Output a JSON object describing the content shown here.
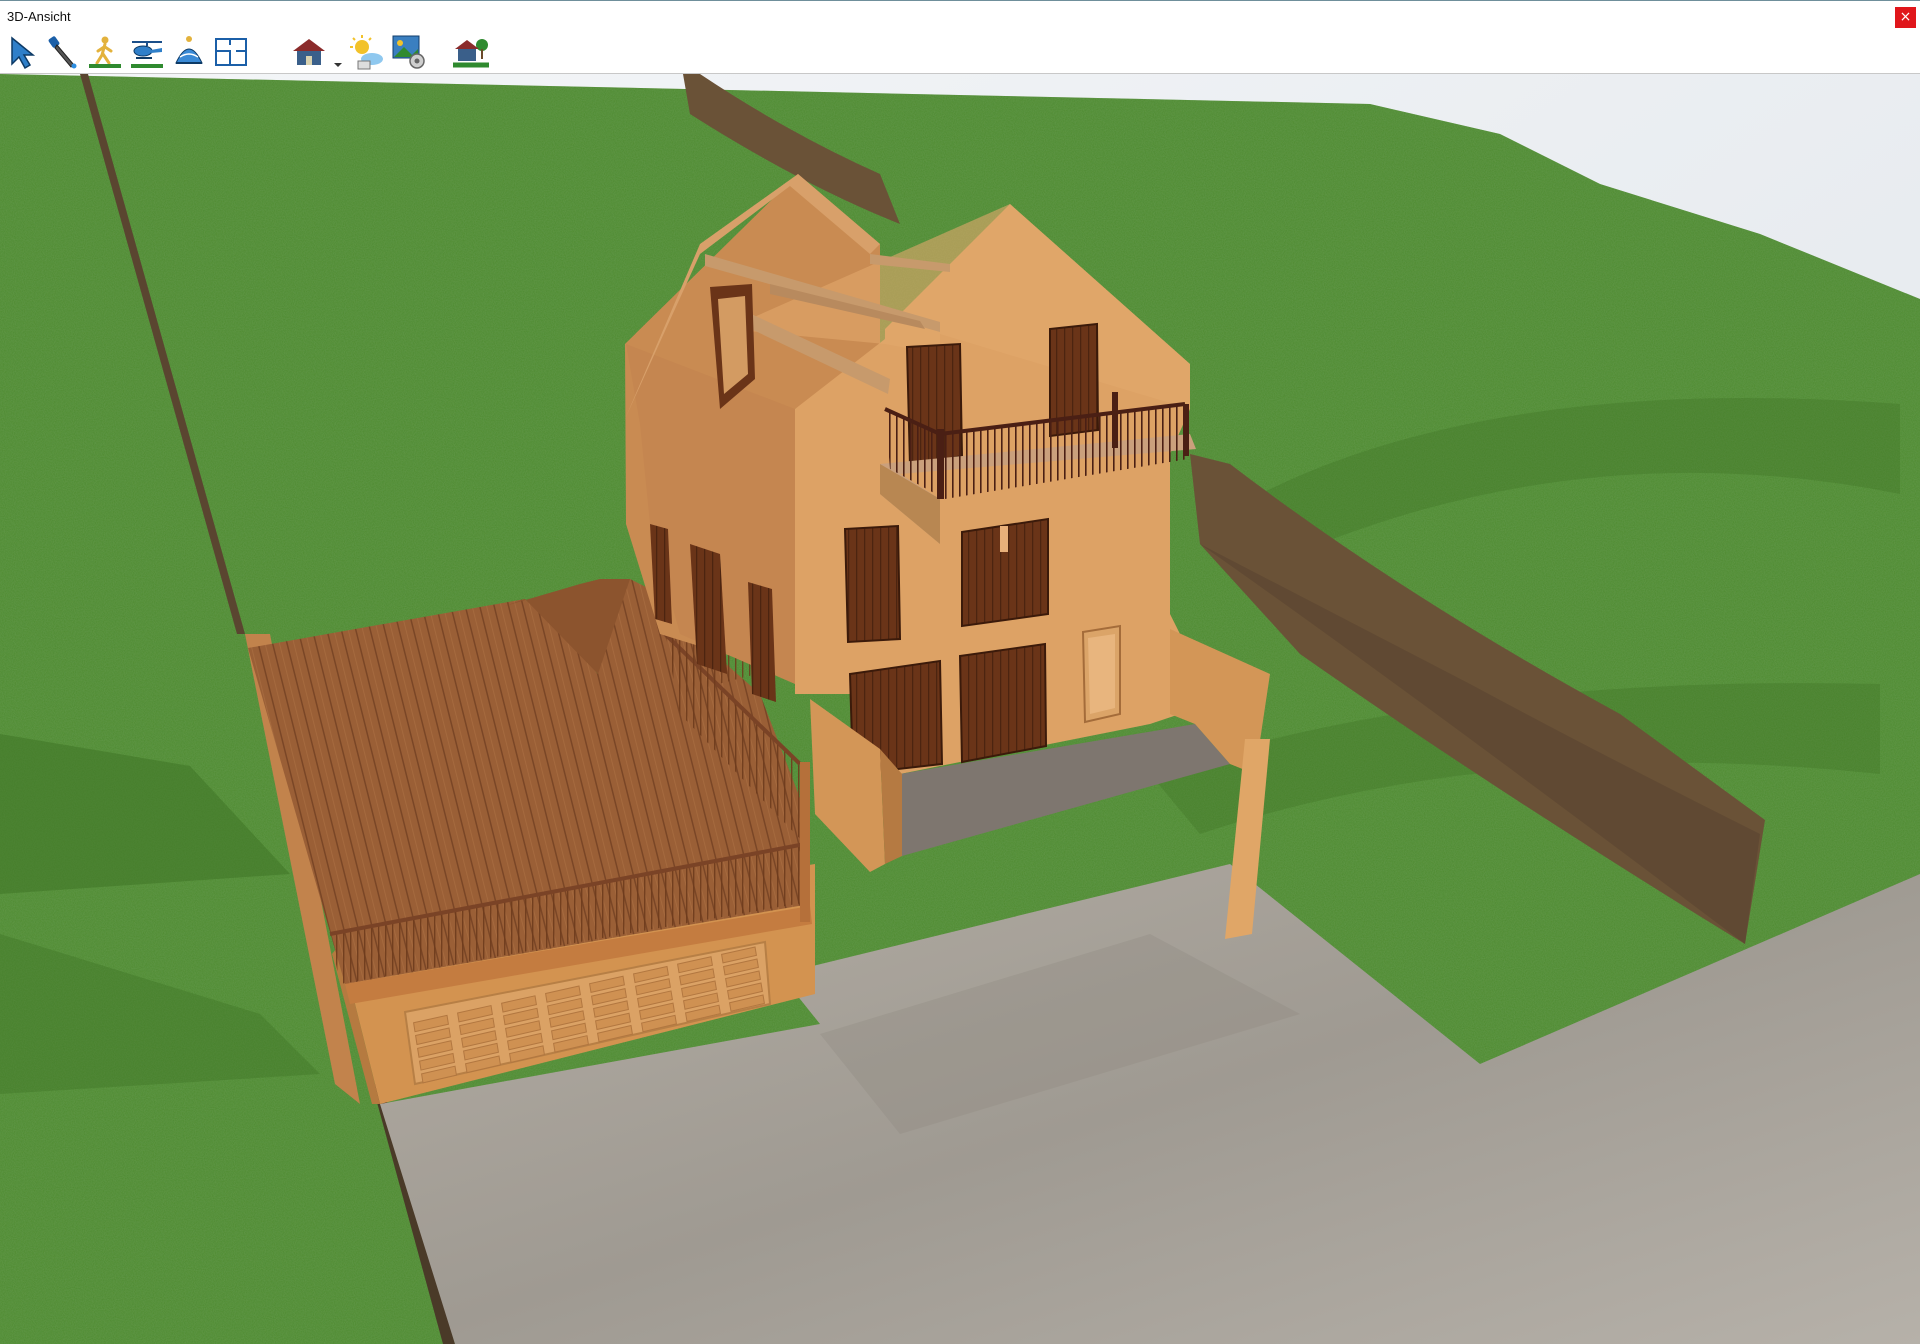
{
  "window": {
    "title": "3D-Ansicht",
    "close_label": "×"
  },
  "toolbar": {
    "tools": [
      {
        "icon": "select-arrow-icon"
      },
      {
        "icon": "eyedropper-icon"
      },
      {
        "icon": "walk-person-icon"
      },
      {
        "icon": "helicopter-icon"
      },
      {
        "icon": "orbit-view-icon"
      },
      {
        "icon": "floor-plan-icon"
      },
      {
        "icon": "house-view-icon"
      },
      {
        "icon": "sun-settings-icon"
      },
      {
        "icon": "render-settings-icon"
      },
      {
        "icon": "terrain-house-icon"
      }
    ]
  },
  "colors": {
    "grass": "#4e8a2f",
    "wall": "#d9975b",
    "wood": "#9a5f36",
    "pavement": "#a9a49c",
    "earth": "#6a5237",
    "sky": "#eef1f4"
  }
}
